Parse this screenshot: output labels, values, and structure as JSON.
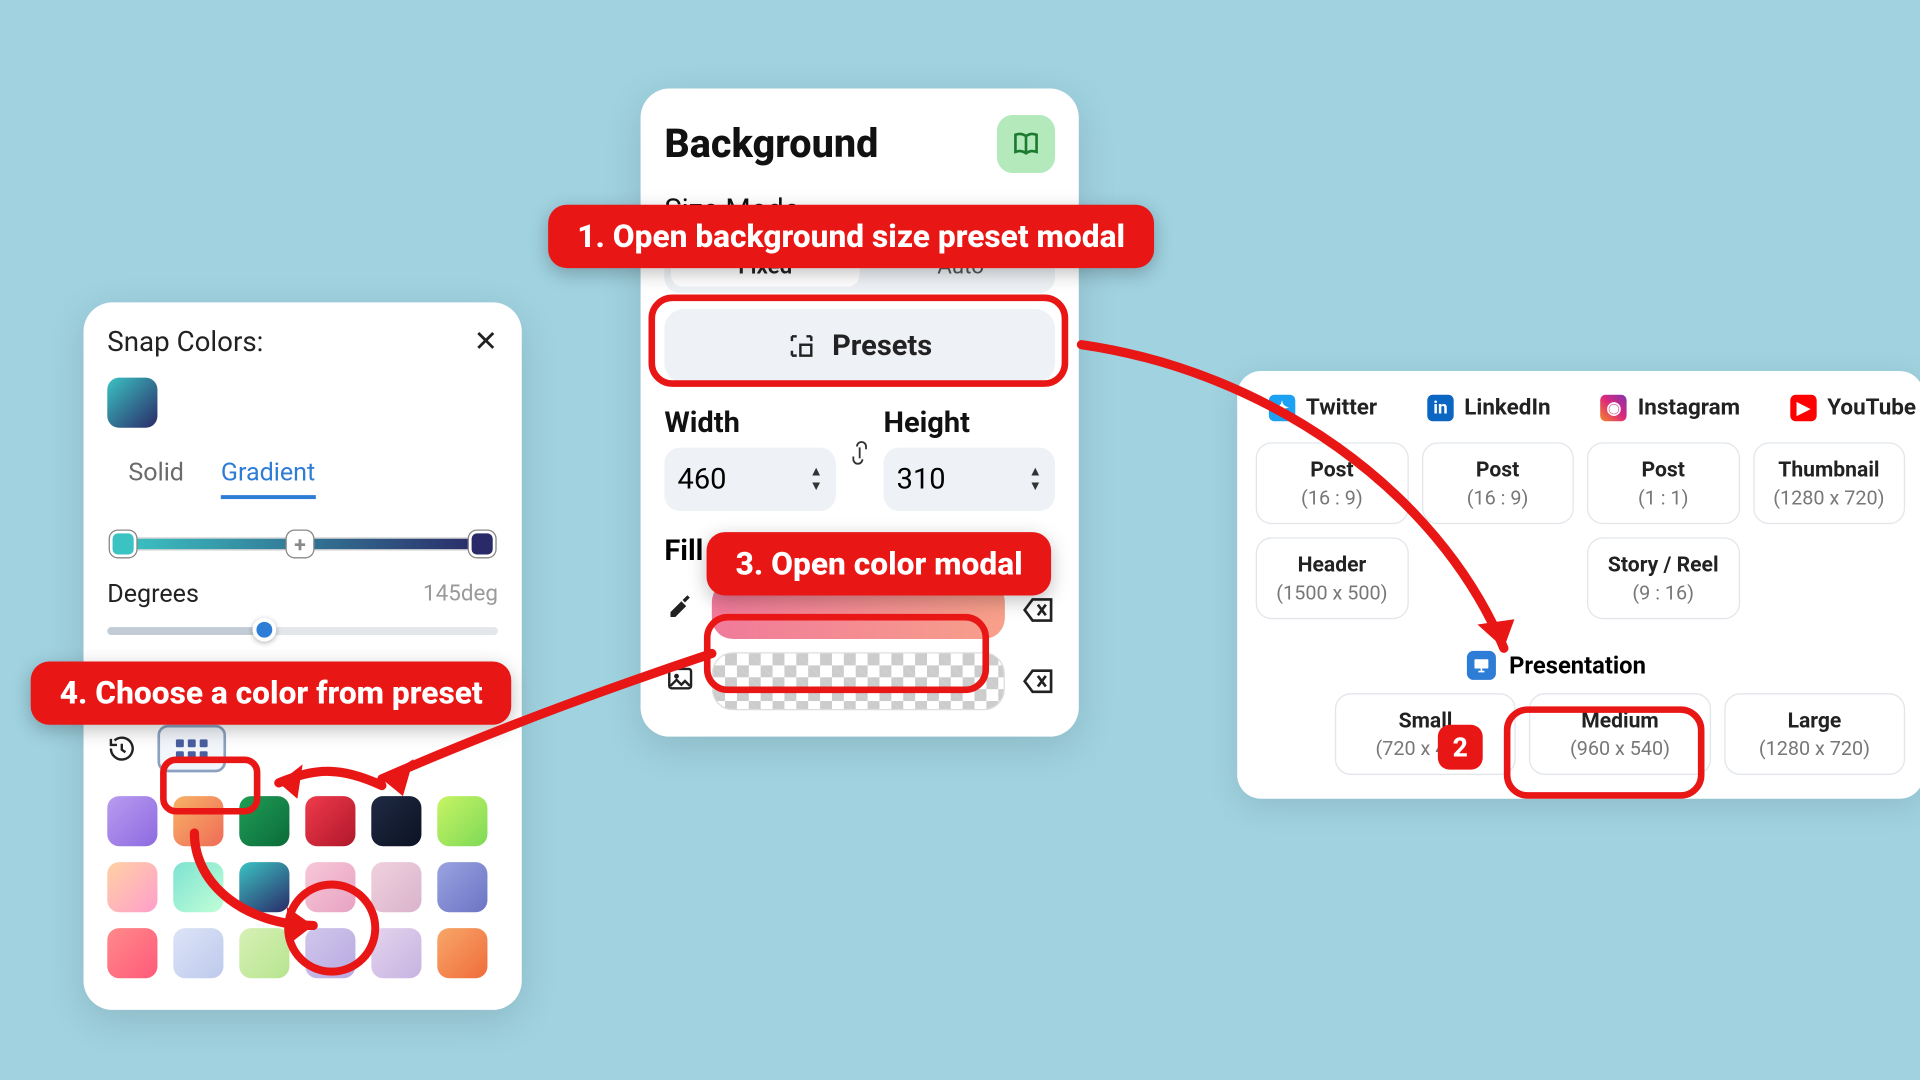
{
  "snap": {
    "title": "Snap Colors:",
    "tabs": {
      "solid": "Solid",
      "gradient": "Gradient"
    },
    "degrees_label": "Degrees",
    "degrees_value": "145deg"
  },
  "bg": {
    "title": "Background",
    "size_mode_label": "Size Mode",
    "fixed": "Fixed",
    "auto": "Auto",
    "presets_label": "Presets",
    "width_label": "Width",
    "height_label": "Height",
    "width_val": "460",
    "height_val": "310",
    "fill_label": "Fill"
  },
  "presets": {
    "platforms": [
      "Twitter",
      "LinkedIn",
      "Instagram",
      "YouTube"
    ],
    "row1": [
      {
        "l1": "Post",
        "l2": "(16 : 9)"
      },
      {
        "l1": "Post",
        "l2": "(16 : 9)"
      },
      {
        "l1": "Post",
        "l2": "(1 : 1)"
      },
      {
        "l1": "Thumbnail",
        "l2": "(1280 x 720)"
      }
    ],
    "row2": [
      {
        "l1": "Header",
        "l2": "(1500 x 500)"
      },
      {
        "l1": "",
        "l2": ""
      },
      {
        "l1": "Story / Reel",
        "l2": "(9 : 16)"
      },
      {
        "l1": "",
        "l2": ""
      }
    ],
    "presentation_label": "Presentation",
    "sizes": [
      {
        "l1": "Small",
        "l2": "(720 x 405)"
      },
      {
        "l1": "Medium",
        "l2": "(960 x 540)"
      },
      {
        "l1": "Large",
        "l2": "(1280 x 720)"
      }
    ]
  },
  "callouts": {
    "c1": "1. Open background size preset modal",
    "c2": "2",
    "c3": "3. Open color modal",
    "c4": "4. Choose a color from preset"
  },
  "swatches": [
    "linear-gradient(135deg,#b99cf0,#8d6ae0)",
    "linear-gradient(135deg,#f7b267,#ef6c57)",
    "linear-gradient(135deg,#1f9d55,#0b6b3a)",
    "linear-gradient(135deg,#ef3b4c,#b0172a)",
    "linear-gradient(135deg,#1f2a44,#0b1222)",
    "linear-gradient(135deg,#c7f464,#7ed957)",
    "linear-gradient(135deg,#ffd1a4,#ff9ecb)",
    "linear-gradient(135deg,#7de2d1,#c1ffd7)",
    "linear-gradient(145deg,#3bc3c3,#2a2a68)",
    "linear-gradient(135deg,#f8c7d8,#e7a3c2)",
    "linear-gradient(135deg,#f0d1dd,#d9b3cc)",
    "linear-gradient(135deg,#9aa3e0,#6b74c4)",
    "linear-gradient(135deg,#ff8a8a,#ff5a7a)",
    "linear-gradient(135deg,#dce4f7,#bec9ec)",
    "linear-gradient(135deg,#d6f0b6,#b7e58f)",
    "linear-gradient(135deg,#d1c7ec,#b7a9e0)",
    "linear-gradient(135deg,#e4d3ee,#c7b3e0)",
    "linear-gradient(135deg,#f8a76a,#ef6c3a)"
  ]
}
